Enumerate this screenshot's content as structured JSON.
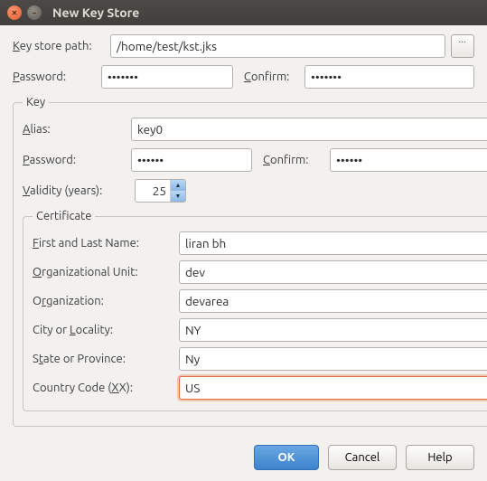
{
  "window": {
    "title": "New Key Store"
  },
  "keystore": {
    "path_label": "Key store path:",
    "path": "/home/test/kst.jks",
    "password_label": "Password:",
    "password": "•••••••",
    "confirm_label": "Confirm:",
    "confirm": "•••••••"
  },
  "key": {
    "legend": "Key",
    "alias_label": "Alias:",
    "alias": "key0",
    "password_label": "Password:",
    "password": "••••••",
    "confirm_label": "Confirm:",
    "confirm": "••••••",
    "validity_label": "Validity (years):",
    "validity": "25"
  },
  "cert": {
    "legend": "Certificate",
    "first_last_label": "First and Last Name:",
    "first_last": "liran bh",
    "org_unit_label": "Organizational Unit:",
    "org_unit": "dev",
    "org_label": "Organization:",
    "org": "devarea",
    "city_label": "City or Locality:",
    "city": "NY",
    "state_label": "State or Province:",
    "state": "Ny",
    "country_label": "Country Code (XX):",
    "country": "US"
  },
  "buttons": {
    "ok": "OK",
    "cancel": "Cancel",
    "help": "Help",
    "browse": "..."
  }
}
